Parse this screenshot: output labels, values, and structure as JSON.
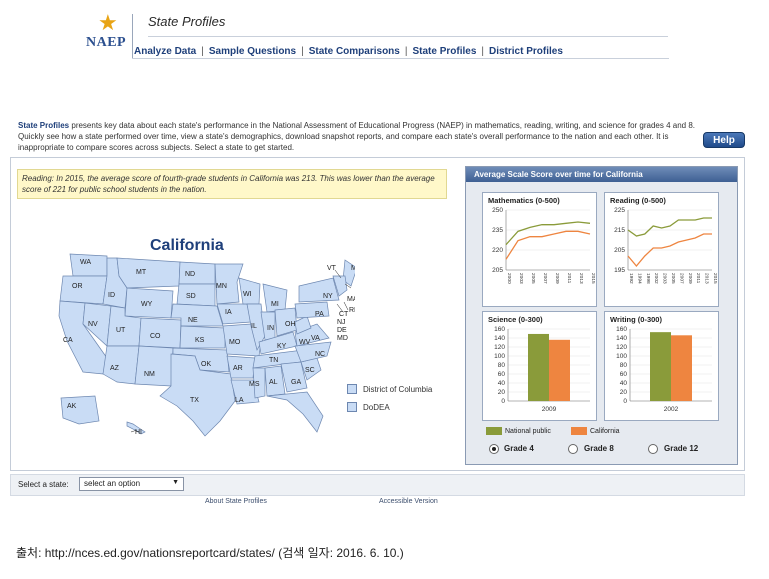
{
  "header": {
    "logo_text": "NAEP",
    "title": "State Profiles",
    "nav": [
      "Analyze Data",
      "Sample Questions",
      "State Comparisons",
      "State Profiles",
      "District Profiles"
    ]
  },
  "intro": {
    "lead": "State Profiles",
    "text": " presents key data about each state's performance in the National Assessment of Educational Progress (NAEP) in mathematics, reading, writing, and science for grades 4 and 8. Quickly see how a state performed over time, view a state's demographics, download snapshot reports, and compare each state's overall performance to the nation and each other. It is inappropriate to compare scores across subjects. Select a state to get started."
  },
  "help_label": "Help",
  "callout": "Reading: In 2015, the average score of fourth-grade students in California was 213. This was lower than the average score of 221 for public school students in the nation.",
  "map": {
    "selected_state": "California",
    "legend": [
      "District of Columbia",
      "DoDEA"
    ]
  },
  "right_panel": {
    "title": "Average Scale Score over time for California",
    "legend": {
      "national": "National public",
      "state": "California"
    },
    "grades": [
      "Grade 4",
      "Grade 8",
      "Grade 12"
    ],
    "selected_grade": "Grade 4"
  },
  "chart_data": [
    {
      "type": "line",
      "title": "Mathematics (0-500)",
      "ylim": [
        205,
        250
      ],
      "yticks": [
        205,
        220,
        235,
        250
      ],
      "x": [
        "2000",
        "2003",
        "2005",
        "2007",
        "2009",
        "2011",
        "2013",
        "2015"
      ],
      "series": [
        {
          "name": "National public",
          "values": [
            224,
            234,
            237,
            239,
            239,
            240,
            241,
            240
          ]
        },
        {
          "name": "California",
          "values": [
            213,
            227,
            230,
            230,
            232,
            234,
            234,
            232
          ]
        }
      ]
    },
    {
      "type": "line",
      "title": "Reading (0-500)",
      "ylim": [
        195,
        225
      ],
      "yticks": [
        195,
        205,
        215,
        225
      ],
      "x": [
        "1992",
        "1994",
        "1998",
        "2002",
        "2003",
        "2005",
        "2007",
        "2009",
        "2011",
        "2013",
        "2015"
      ],
      "series": [
        {
          "name": "National public",
          "values": [
            215,
            212,
            213,
            217,
            216,
            217,
            220,
            220,
            220,
            221,
            221
          ]
        },
        {
          "name": "California",
          "values": [
            202,
            197,
            202,
            206,
            206,
            207,
            209,
            210,
            211,
            213,
            213
          ]
        }
      ]
    },
    {
      "type": "bar",
      "title": "Science (0-300)",
      "ylim": [
        0,
        160
      ],
      "yticks": [
        0,
        20,
        40,
        60,
        80,
        100,
        120,
        140,
        160
      ],
      "categories": [
        "2009"
      ],
      "series": [
        {
          "name": "National public",
          "values": [
            149
          ]
        },
        {
          "name": "California",
          "values": [
            136
          ]
        }
      ]
    },
    {
      "type": "bar",
      "title": "Writing (0-300)",
      "ylim": [
        0,
        160
      ],
      "yticks": [
        0,
        20,
        40,
        60,
        80,
        100,
        120,
        140,
        160
      ],
      "categories": [
        "2002"
      ],
      "series": [
        {
          "name": "National public",
          "values": [
            153
          ]
        },
        {
          "name": "California",
          "values": [
            146
          ]
        }
      ]
    }
  ],
  "colors": {
    "national": "#8a9b3a",
    "state": "#ee8540",
    "map_fill": "#c9dcf5",
    "map_stroke": "#6d87b0"
  },
  "select": {
    "label": "Select a state:",
    "value": "select an option"
  },
  "footer": {
    "about": "About State Profiles",
    "accessible": "Accessible Version"
  },
  "source": "출처: http://nces.ed.gov/nationsreportcard/states/ (검색 일자: 2016. 6. 10.)"
}
